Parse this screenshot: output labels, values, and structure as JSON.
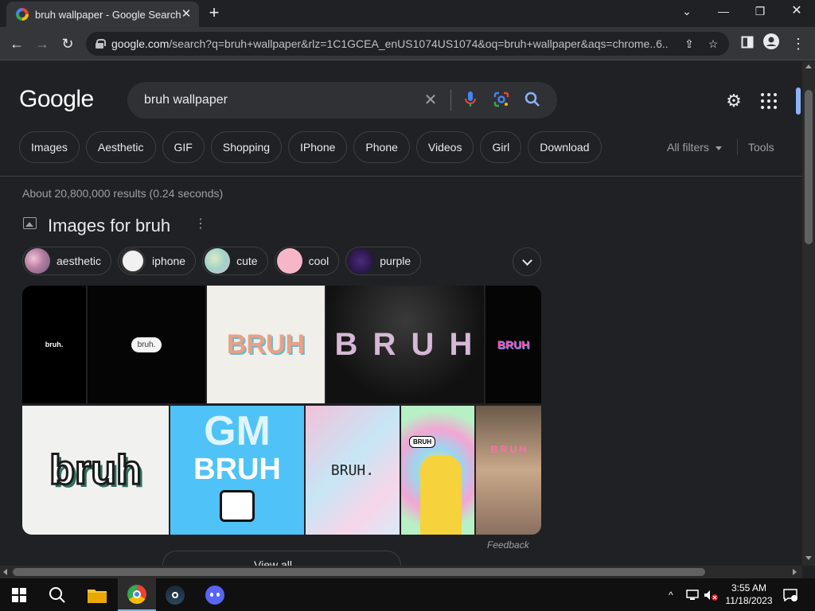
{
  "browser": {
    "tab_title": "bruh wallpaper - Google Search",
    "url_host": "google.com",
    "url_rest": "/search?q=bruh+wallpaper&rlz=1C1GCEA_enUS1074US1074&oq=bruh+wallpaper&aqs=chrome..6..."
  },
  "google": {
    "logo": "Google",
    "query": "bruh wallpaper",
    "filter_chips": [
      "Images",
      "Aesthetic",
      "GIF",
      "Shopping",
      "IPhone",
      "Phone",
      "Videos",
      "Girl",
      "Download"
    ],
    "all_filters": "All filters",
    "tools": "Tools",
    "results_stats": "About 20,800,000 results (0.24 seconds)"
  },
  "images_section": {
    "title": "Images for bruh",
    "sub_chips": [
      "aesthetic",
      "iphone",
      "cute",
      "cool",
      "purple"
    ],
    "tiles": {
      "t1": "bruh.",
      "t2": "bruh.",
      "t3": "BRUH",
      "t4": "B R U H",
      "t5": "BRUH",
      "t6": "bruh",
      "t7a": "GM",
      "t7b": "BRUH",
      "t8": "BRUH.",
      "t9": "BRUH",
      "t10": "B R U H"
    },
    "feedback": "Feedback",
    "view_all": "View all"
  },
  "taskbar": {
    "time": "3:55 AM",
    "date": "11/18/2023"
  },
  "colors": {
    "page_bg": "#202124",
    "chip_border": "#3c4043",
    "link_blue": "#8ab4f8",
    "toolbar": "#35363a"
  }
}
